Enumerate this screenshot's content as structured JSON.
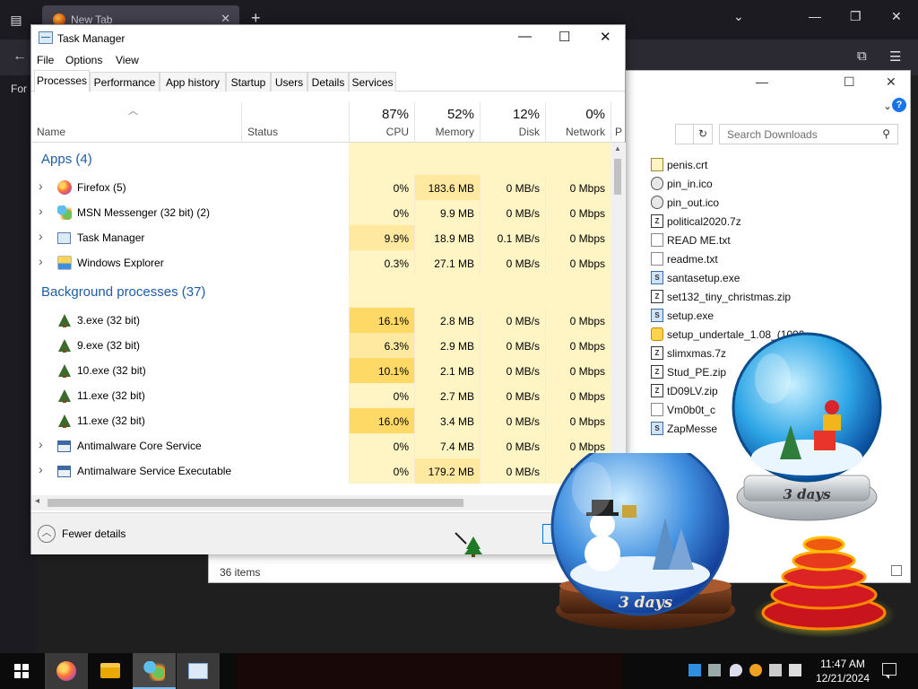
{
  "firefox": {
    "tab_title": "New Tab",
    "side_text": "For",
    "icons": [
      "tab-list-icon",
      "firefox-icon",
      "close-tab-icon",
      "new-tab-icon",
      "list-all-tabs-icon",
      "minimize-icon",
      "restore-icon",
      "close-icon",
      "back-icon",
      "extensions-icon",
      "menu-icon"
    ]
  },
  "explorer": {
    "search_placeholder": "Search Downloads",
    "item_count": "36 items",
    "files": [
      {
        "name": "penis.crt",
        "type": "crt"
      },
      {
        "name": "pin_in.ico",
        "type": "ico"
      },
      {
        "name": "pin_out.ico",
        "type": "ico"
      },
      {
        "name": "political2020.7z",
        "type": "zip"
      },
      {
        "name": "READ ME.txt",
        "type": "txt"
      },
      {
        "name": "readme.txt",
        "type": "txt"
      },
      {
        "name": "santasetup.exe",
        "type": "exe"
      },
      {
        "name": "set132_tiny_christmas.zip",
        "type": "zip"
      },
      {
        "name": "setup.exe",
        "type": "exe"
      },
      {
        "name": "setup_undertale_1.08_(1090",
        "type": "yel"
      },
      {
        "name": "slimxmas.7z",
        "type": "zip"
      },
      {
        "name": "Stud_PE.zip",
        "type": "zip"
      },
      {
        "name": "tD09LV.zip",
        "type": "zip"
      },
      {
        "name": "Vm0b0t_c",
        "type": "txt"
      },
      {
        "name": "ZapMesse",
        "type": "exe"
      }
    ]
  },
  "taskmgr": {
    "title": "Task Manager",
    "menu": [
      "File",
      "Options",
      "View"
    ],
    "tabs": [
      "Processes",
      "Performance",
      "App history",
      "Startup",
      "Users",
      "Details",
      "Services"
    ],
    "columns": {
      "name": "Name",
      "status": "Status",
      "cpu": {
        "pct": "87%",
        "label": "CPU"
      },
      "memory": {
        "pct": "52%",
        "label": "Memory"
      },
      "disk": {
        "pct": "12%",
        "label": "Disk"
      },
      "network": {
        "pct": "0%",
        "label": "Network"
      },
      "partial": "P"
    },
    "groups": {
      "apps": "Apps (4)",
      "background": "Background processes (37)"
    },
    "apps": [
      {
        "name": "Firefox (5)",
        "icon": "firefox-icon",
        "cpu": "0%",
        "memory": "183.6 MB",
        "disk": "0 MB/s",
        "network": "0 Mbps"
      },
      {
        "name": "MSN Messenger (32 bit) (2)",
        "icon": "msn-icon",
        "cpu": "0%",
        "memory": "9.9 MB",
        "disk": "0 MB/s",
        "network": "0 Mbps"
      },
      {
        "name": "Task Manager",
        "icon": "task-manager-icon",
        "cpu": "9.9%",
        "memory": "18.9 MB",
        "disk": "0.1 MB/s",
        "network": "0 Mbps"
      },
      {
        "name": "Windows Explorer",
        "icon": "explorer-icon",
        "cpu": "0.3%",
        "memory": "27.1 MB",
        "disk": "0 MB/s",
        "network": "0 Mbps"
      }
    ],
    "background": [
      {
        "name": "3.exe (32 bit)",
        "icon": "tree-icon",
        "cpu": "16.1%",
        "memory": "2.8 MB",
        "disk": "0 MB/s",
        "network": "0 Mbps"
      },
      {
        "name": "9.exe (32 bit)",
        "icon": "tree-icon",
        "cpu": "6.3%",
        "memory": "2.9 MB",
        "disk": "0 MB/s",
        "network": "0 Mbps"
      },
      {
        "name": "10.exe (32 bit)",
        "icon": "tree-icon",
        "cpu": "10.1%",
        "memory": "2.1 MB",
        "disk": "0 MB/s",
        "network": "0 Mbps"
      },
      {
        "name": "11.exe (32 bit)",
        "icon": "tree-icon",
        "cpu": "0%",
        "memory": "2.7 MB",
        "disk": "0 MB/s",
        "network": "0 Mbps"
      },
      {
        "name": "11.exe (32 bit)",
        "icon": "tree-icon",
        "cpu": "16.0%",
        "memory": "3.4 MB",
        "disk": "0 MB/s",
        "network": "0 Mbps"
      },
      {
        "name": "Antimalware Core Service",
        "icon": "service-icon",
        "cpu": "0%",
        "memory": "7.4 MB",
        "disk": "0 MB/s",
        "network": "0 Mbps"
      },
      {
        "name": "Antimalware Service Executable",
        "icon": "service-icon",
        "cpu": "0%",
        "memory": "179.2 MB",
        "disk": "0 MB/s",
        "network": "0 Mbps"
      }
    ],
    "fewer_details": "Fewer details"
  },
  "globes": {
    "front_label": "3 days",
    "back_label": "3 days"
  },
  "taskbar": {
    "time": "11:47 AM",
    "date": "12/21/2024",
    "pinned": [
      "start-icon",
      "firefox-icon",
      "file-explorer-icon",
      "msn-messenger-icon",
      "task-manager-icon"
    ]
  },
  "colors": {
    "accent_blue": "#1e5ca6",
    "heat_light": "#fff4c4",
    "heat_mid": "#ffe9a0",
    "heat_high": "#ffd966"
  }
}
